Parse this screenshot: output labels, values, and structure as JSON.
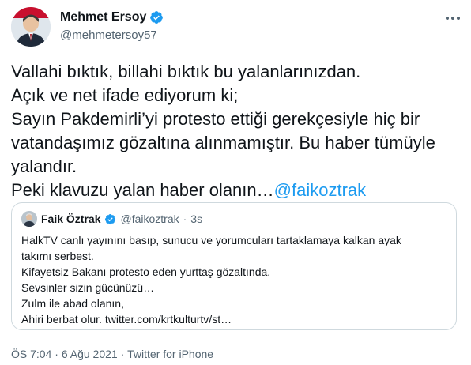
{
  "author": {
    "name": "Mehmet Ersoy",
    "handle": "@mehmetersoy57"
  },
  "tweet": {
    "lines": [
      "Vallahi bıktık, billahi bıktık bu yalanlarınızdan.",
      "Açık ve net ifade ediyorum ki;",
      "Sayın Pakdemirli’yi protesto ettiği gerekçesiyle hiç bir",
      "vatandaşımız gözaltına alınmamıştır. Bu haber tümüyle",
      "yalandır."
    ],
    "last_line_prefix": "Peki klavuzu yalan haber olanın…",
    "last_line_mention": "@faikoztrak"
  },
  "quoted": {
    "name": "Faik Öztrak",
    "handle": "@faikoztrak",
    "dot": "·",
    "time": "3s",
    "lines": [
      "HalkTV canlı yayınını basıp, sunucu ve yorumcuları tartaklamaya kalkan ayak",
      "takımı serbest.",
      "Kifayetsiz Bakanı protesto eden yurttaş gözaltında.",
      "Sevsinler sizin gücünüzü…",
      "Zulm ile abad olanın,",
      "Ahiri berbat olur. twitter.com/krtkulturtv/st…"
    ]
  },
  "footer": {
    "time": "ÖS 7:04",
    "sep1": "·",
    "date": "6 Ağu 2021",
    "sep2": "·",
    "source": "Twitter for iPhone"
  },
  "colors": {
    "text": "#0f1419",
    "secondary": "#536471",
    "accent": "#1d9bf0",
    "border": "#cfd9de"
  },
  "icons": [
    "avatar",
    "verified-badge-icon",
    "more-options-icon"
  ]
}
